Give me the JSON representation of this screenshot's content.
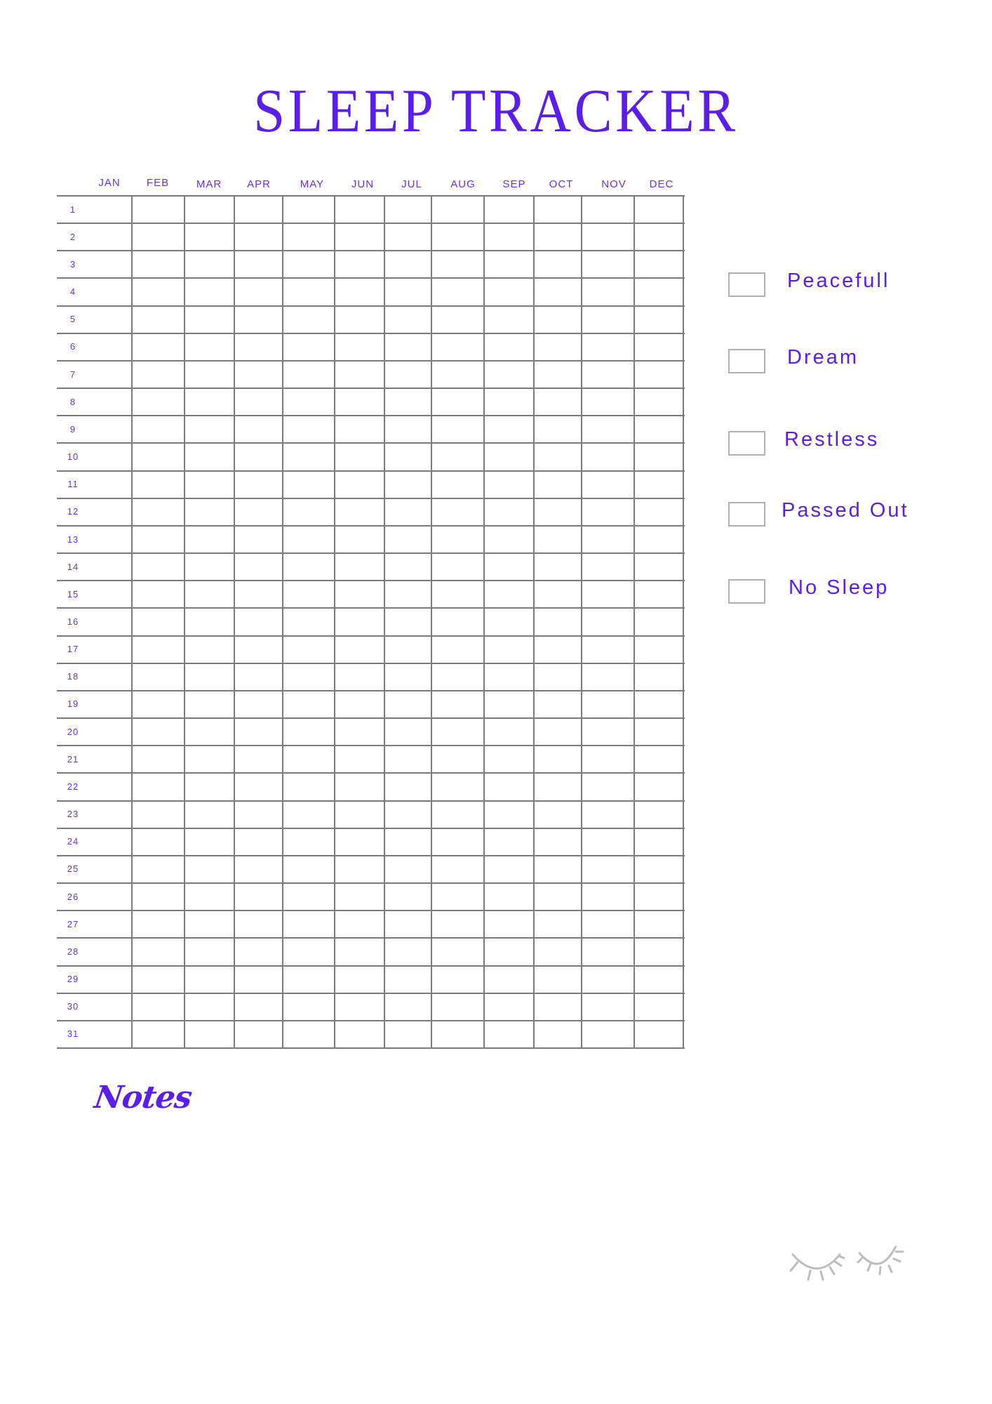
{
  "header": {
    "title": "SLEEP TRACKER"
  },
  "tracker": {
    "months": [
      "JAN",
      "FEB",
      "MAR",
      "APR",
      "MAY",
      "JUN",
      "JUL",
      "AUG",
      "SEP",
      "OCT",
      "NOV",
      "DEC"
    ],
    "days": [
      "1",
      "2",
      "3",
      "4",
      "5",
      "6",
      "7",
      "8",
      "9",
      "10",
      "11",
      "12",
      "13",
      "14",
      "15",
      "16",
      "17",
      "18",
      "19",
      "20",
      "21",
      "22",
      "23",
      "24",
      "25",
      "26",
      "27",
      "28",
      "29",
      "30",
      "31"
    ]
  },
  "legend": {
    "items": [
      {
        "label": "Peacefull",
        "checked": false
      },
      {
        "label": "Dream",
        "checked": false
      },
      {
        "label": "Restless",
        "checked": false
      },
      {
        "label": "Passed Out",
        "checked": false
      },
      {
        "label": "No Sleep",
        "checked": false
      }
    ]
  },
  "notes": {
    "heading": "Notes"
  },
  "decoration": {
    "icon": "closed-eyes-icon"
  },
  "colors": {
    "accent": "#5b1ee8",
    "grid": "#7b7b7b",
    "checkbox_border": "#b0b0b0",
    "decoration": "#bdbdbd"
  }
}
